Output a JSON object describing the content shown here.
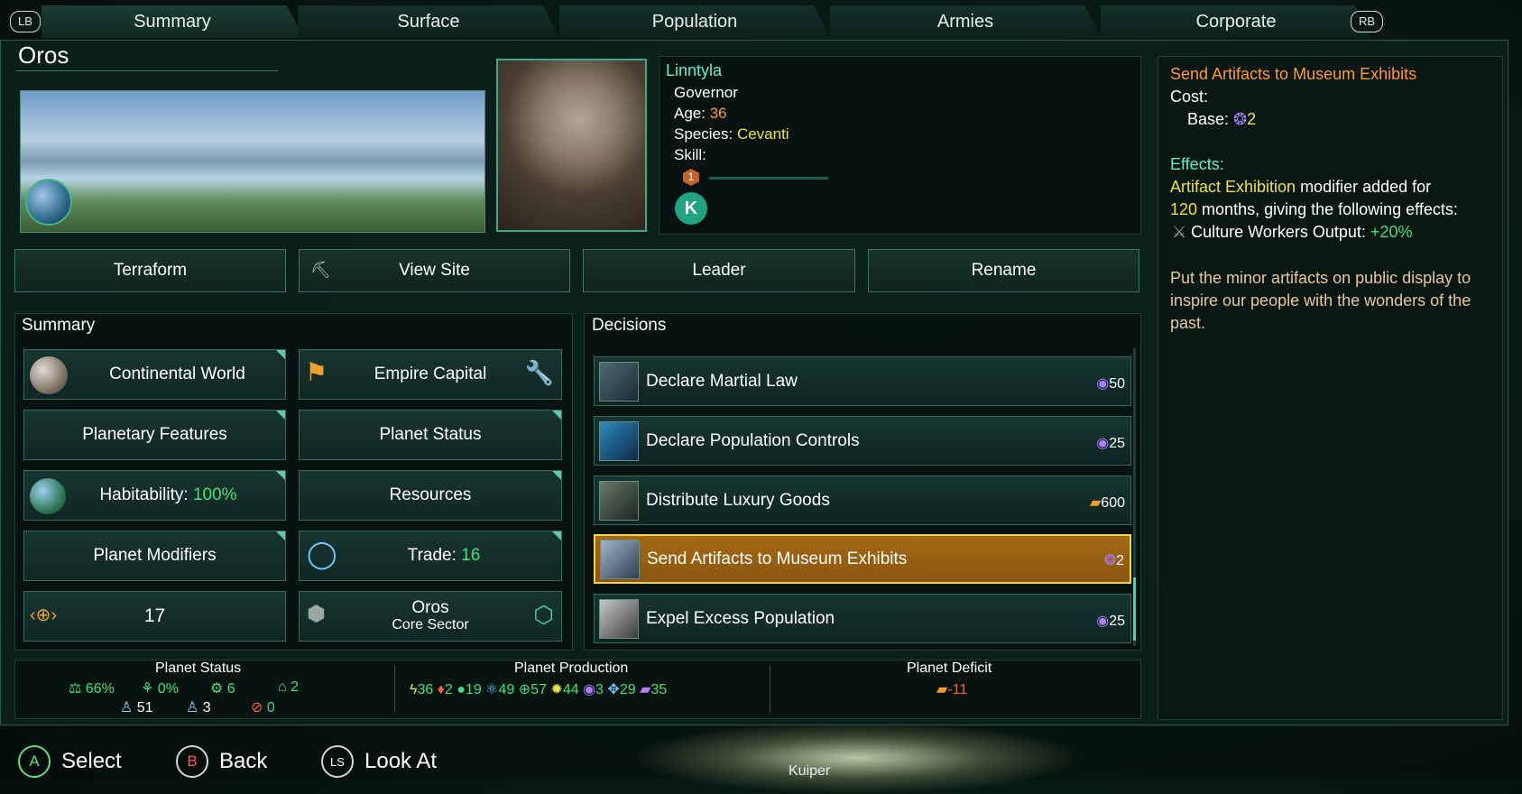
{
  "tabs": {
    "lb": "LB",
    "rb": "RB",
    "items": [
      "Summary",
      "Surface",
      "Population",
      "Armies",
      "Corporate"
    ]
  },
  "planet": {
    "name": "Oros"
  },
  "leader": {
    "name": "Linntyla",
    "role": "Governor",
    "age_label": "Age:",
    "age": "36",
    "species_label": "Species:",
    "species": "Cevanti",
    "skill_label": "Skill:",
    "skill_level": "1",
    "skill_progress": 0
  },
  "actions": {
    "terraform": "Terraform",
    "view_site": "View Site",
    "leader": "Leader",
    "rename": "Rename"
  },
  "summary": {
    "title": "Summary",
    "continental": "Continental World",
    "empire_capital": "Empire Capital",
    "features": "Planetary Features",
    "planet_status": "Planet Status",
    "habitability_label": "Habitability:",
    "habitability_value": "100%",
    "resources": "Resources",
    "modifiers": "Planet Modifiers",
    "trade_label": "Trade:",
    "trade_value": "16",
    "size": "17",
    "sector_name": "Oros",
    "sector_sub": "Core Sector"
  },
  "decisions": {
    "title": "Decisions",
    "items": [
      {
        "label": "Declare Martial Law",
        "cost": "50",
        "cost_icon": "unity-icon",
        "cost_color": "#a77cff"
      },
      {
        "label": "Declare Population Controls",
        "cost": "25",
        "cost_icon": "unity-icon",
        "cost_color": "#a77cff"
      },
      {
        "label": "Distribute Luxury Goods",
        "cost": "600",
        "cost_icon": "consumer-goods-icon",
        "cost_color": "#ff9a2e"
      },
      {
        "label": "Send Artifacts to Museum Exhibits",
        "cost": "2",
        "cost_icon": "minor-artifacts-icon",
        "cost_color": "#a77cff"
      },
      {
        "label": "Expel Excess Population",
        "cost": "25",
        "cost_icon": "unity-icon",
        "cost_color": "#a77cff"
      }
    ]
  },
  "tooltip": {
    "title": "Send Artifacts to Museum Exhibits",
    "cost_label": "Cost:",
    "base_label": "Base:",
    "base_value": "2",
    "effects_label": "Effects:",
    "modifier_name": "Artifact Exhibition",
    "modifier_text": " modifier added for",
    "duration": "120",
    "duration_text": " months, giving the following effects:",
    "effect_line": "Culture Workers Output:",
    "effect_value": "+20%",
    "description": "Put the minor artifacts on public display to inspire our people with the wonders of the past."
  },
  "status_bar": {
    "planet_status_title": "Planet Status",
    "stability": "66%",
    "crime": "0%",
    "amenities": "6",
    "housing": "2",
    "pops": "51",
    "unemployed": "3",
    "deviancy": "0",
    "production_title": "Planet Production",
    "energy": "36",
    "minerals": "2",
    "food": "19",
    "research_physics": "49",
    "research_society": "57",
    "alloys": "44",
    "unity": "3",
    "trade": "29",
    "goods": "35",
    "deficit_title": "Planet Deficit",
    "deficit": "-11"
  },
  "controls": {
    "select": "Select",
    "back": "Back",
    "look_at": "Look At",
    "a": "A",
    "b": "B",
    "ls": "LS"
  },
  "map_label": "Kuiper"
}
